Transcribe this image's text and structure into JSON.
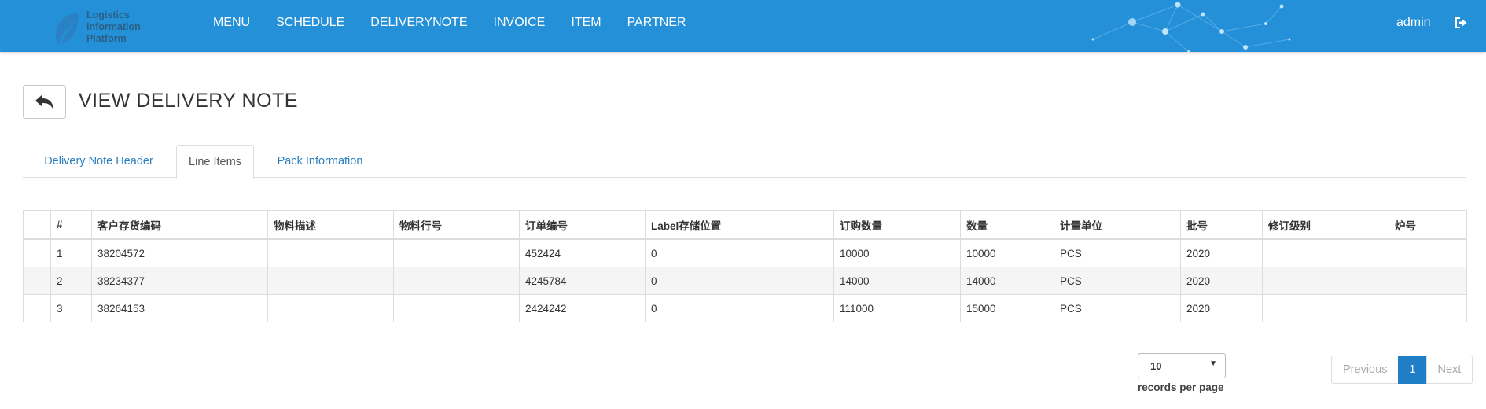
{
  "app": {
    "logo_lines": [
      "Logistics",
      "Information",
      "Platform"
    ],
    "colors": {
      "navbar": "#2490d8",
      "accent": "#1f7ec6",
      "link": "#2a7fc0"
    }
  },
  "nav": {
    "items": [
      "MENU",
      "SCHEDULE",
      "DELIVERYNOTE",
      "INVOICE",
      "ITEM",
      "PARTNER"
    ],
    "user": "admin",
    "logout_icon": "sign-out-icon"
  },
  "page": {
    "title": "VIEW DELIVERY NOTE",
    "back_icon": "reply-arrow-icon"
  },
  "tabs": [
    {
      "label": "Delivery Note Header",
      "active": false
    },
    {
      "label": "Line Items",
      "active": true
    },
    {
      "label": "Pack Information",
      "active": false
    }
  ],
  "table": {
    "columns": [
      "",
      "#",
      "客户存货编码",
      "物料描述",
      "物料行号",
      "订单编号",
      "Label存储位置",
      "订购数量",
      "数量",
      "计量单位",
      "批号",
      "修订级别",
      "炉号"
    ],
    "rows": [
      [
        "",
        "1",
        "38204572",
        "",
        "",
        "452424",
        "0",
        "10000",
        "10000",
        "PCS",
        "2020",
        "",
        ""
      ],
      [
        "",
        "2",
        "38234377",
        "",
        "",
        "4245784",
        "0",
        "14000",
        "14000",
        "PCS",
        "2020",
        "",
        ""
      ],
      [
        "",
        "3",
        "38264153",
        "",
        "",
        "2424242",
        "0",
        "111000",
        "15000",
        "PCS",
        "2020",
        "",
        ""
      ]
    ]
  },
  "pagination": {
    "page_size": "10",
    "records_label": "records per page",
    "previous": "Previous",
    "current": "1",
    "next": "Next"
  }
}
